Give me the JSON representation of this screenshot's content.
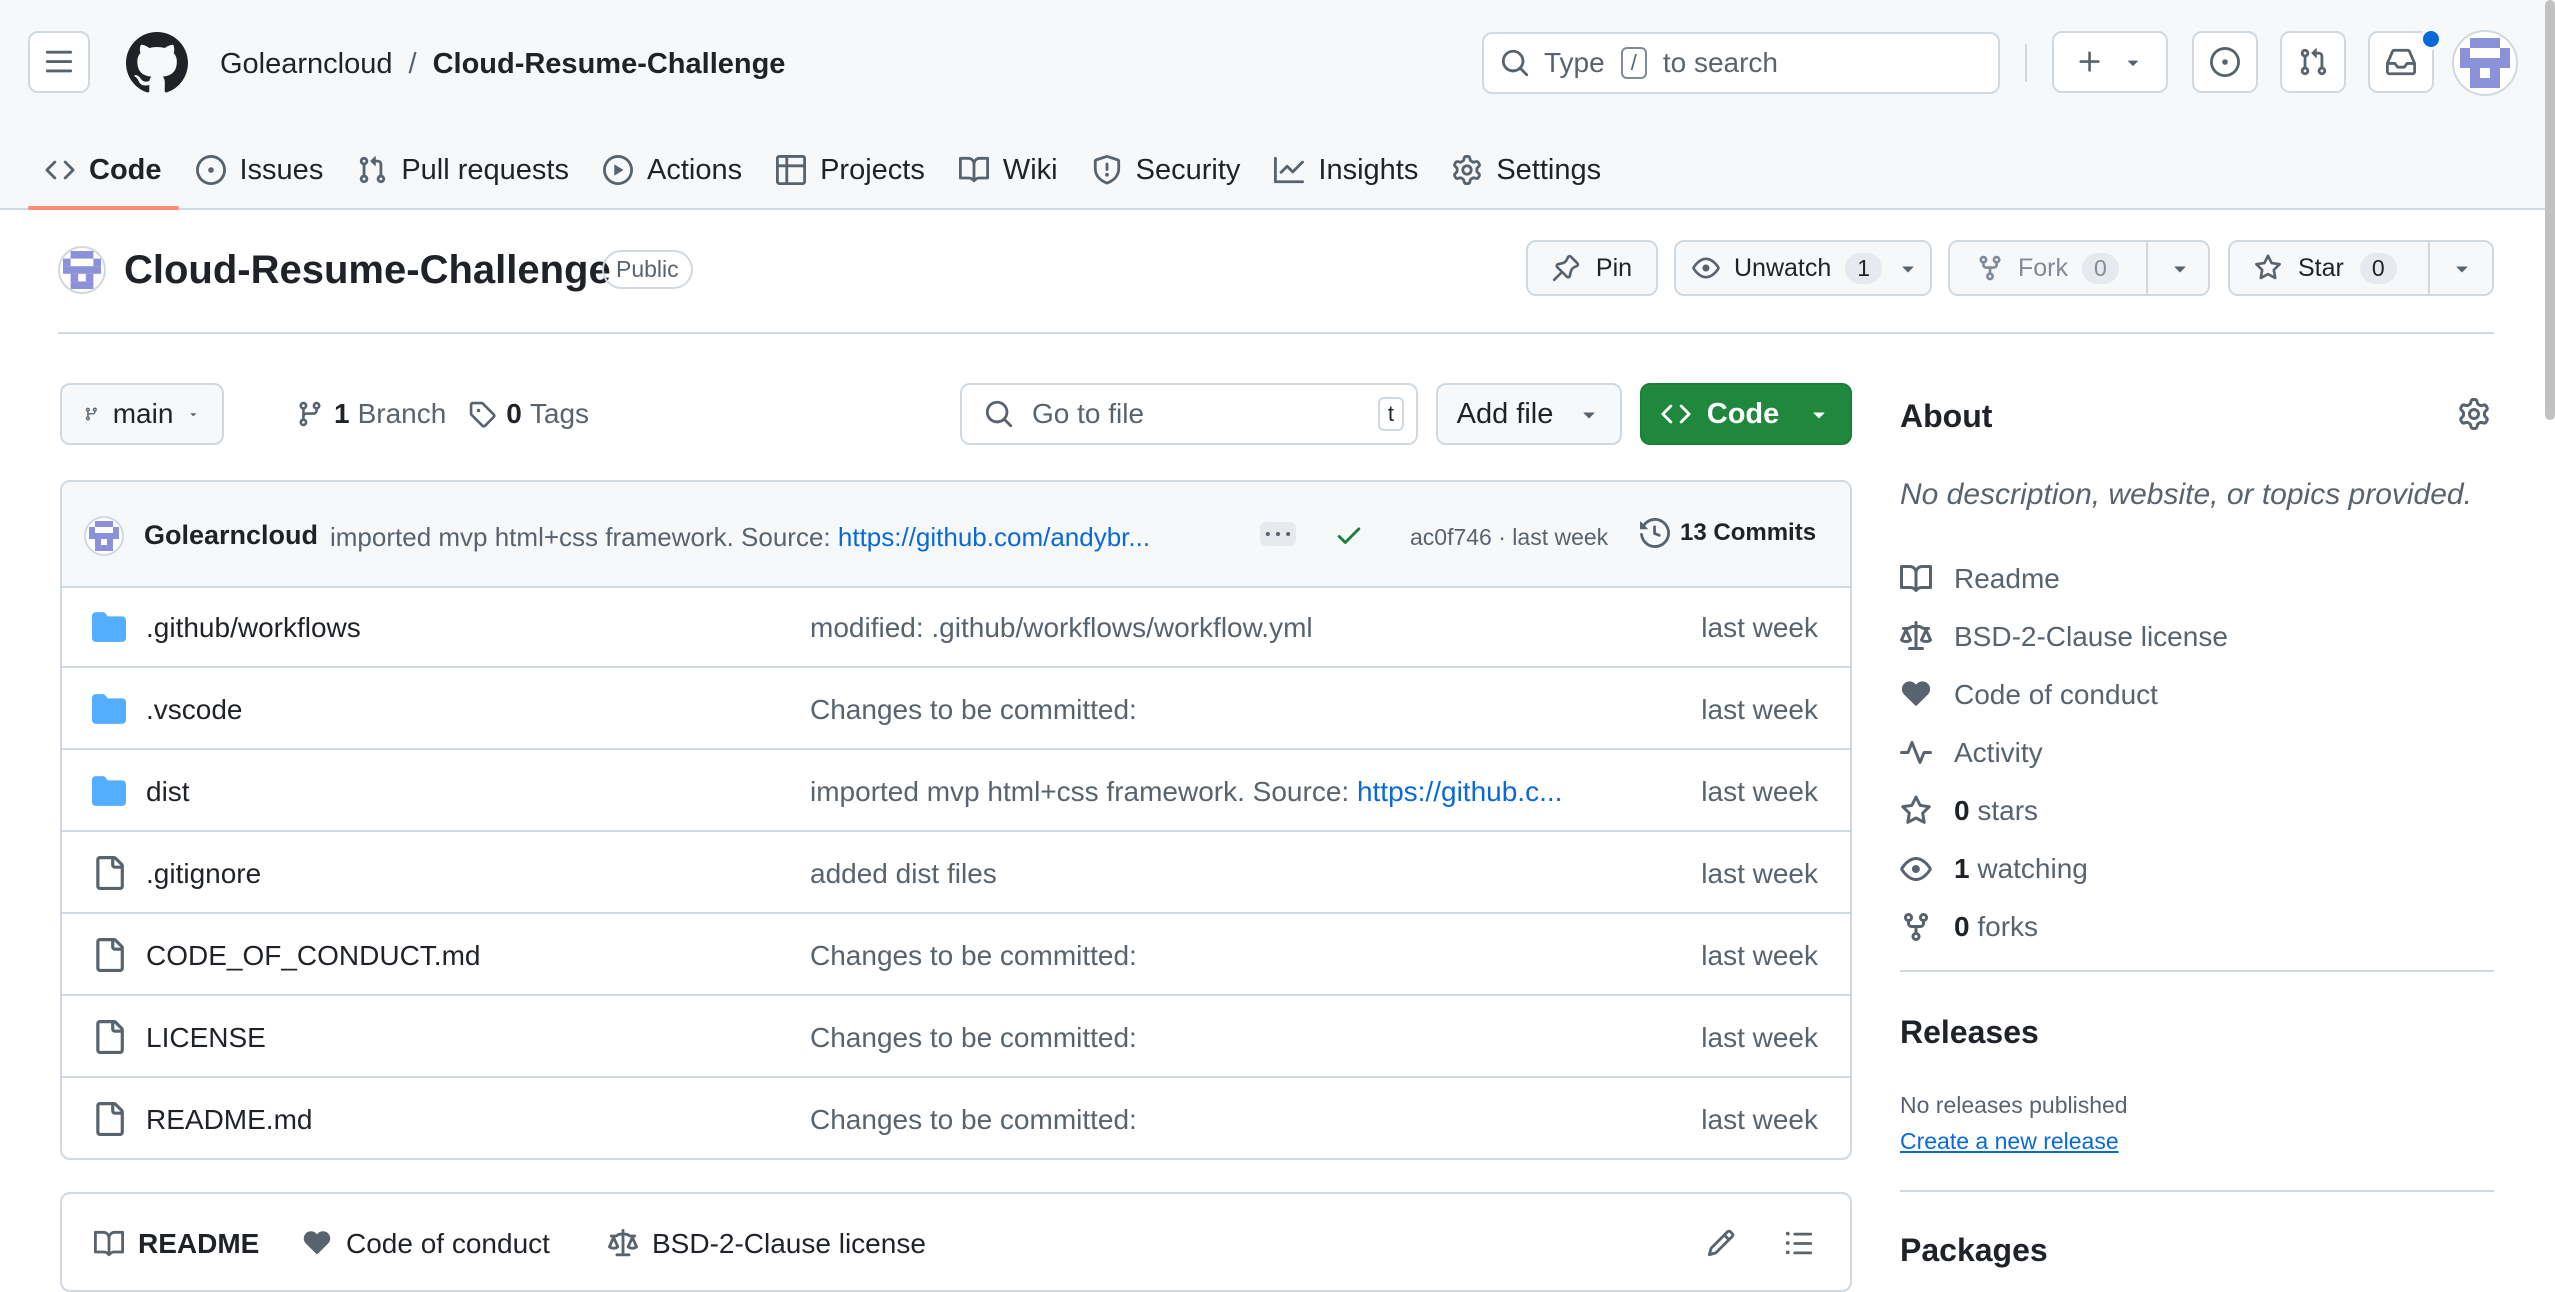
{
  "header": {
    "owner": "Golearncloud",
    "separator": "/",
    "repo": "Cloud-Resume-Challenge",
    "search_prefix": "Type",
    "search_key": "/",
    "search_suffix": "to search"
  },
  "tabs": [
    {
      "label": "Code",
      "icon": "code-icon"
    },
    {
      "label": "Issues",
      "icon": "issue-icon"
    },
    {
      "label": "Pull requests",
      "icon": "pull-request-icon"
    },
    {
      "label": "Actions",
      "icon": "play-icon"
    },
    {
      "label": "Projects",
      "icon": "table-icon"
    },
    {
      "label": "Wiki",
      "icon": "book-icon"
    },
    {
      "label": "Security",
      "icon": "shield-icon"
    },
    {
      "label": "Insights",
      "icon": "graph-icon"
    },
    {
      "label": "Settings",
      "icon": "gear-icon"
    }
  ],
  "repo_header": {
    "title": "Cloud-Resume-Challenge",
    "visibility": "Public",
    "pin_label": "Pin",
    "unwatch_label": "Unwatch",
    "watch_count": "1",
    "fork_label": "Fork",
    "fork_count": "0",
    "star_label": "Star",
    "star_count": "0"
  },
  "toolbar": {
    "branch": "main",
    "branch_count": "1",
    "branch_label": "Branch",
    "tag_count": "0",
    "tag_label": "Tags",
    "goto_placeholder": "Go to file",
    "goto_key": "t",
    "add_file_label": "Add file",
    "code_label": "Code"
  },
  "commit": {
    "author": "Golearncloud",
    "message": "imported mvp html+css framework. Source:",
    "link": "https://github.com/andybr...",
    "hash": "ac0f746 · last week",
    "commits_label": "13 Commits"
  },
  "files": [
    {
      "name": ".github/workflows",
      "type": "folder",
      "msg": "modified: .github/workflows/workflow.yml",
      "link": "",
      "date": "last week"
    },
    {
      "name": ".vscode",
      "type": "folder",
      "msg": "Changes to be committed:",
      "link": "",
      "date": "last week"
    },
    {
      "name": "dist",
      "type": "folder",
      "msg": "imported mvp html+css framework. Source:",
      "link": "https://github.c...",
      "date": "last week"
    },
    {
      "name": ".gitignore",
      "type": "file",
      "msg": "added dist files",
      "link": "",
      "date": "last week"
    },
    {
      "name": "CODE_OF_CONDUCT.md",
      "type": "file",
      "msg": "Changes to be committed:",
      "link": "",
      "date": "last week"
    },
    {
      "name": "LICENSE",
      "type": "file",
      "msg": "Changes to be committed:",
      "link": "",
      "date": "last week"
    },
    {
      "name": "README.md",
      "type": "file",
      "msg": "Changes to be committed:",
      "link": "",
      "date": "last week"
    }
  ],
  "readme_tabs": {
    "readme": "README",
    "conduct": "Code of conduct",
    "license": "BSD-2-Clause license"
  },
  "about": {
    "title": "About",
    "description": "No description, website, or topics provided.",
    "readme": "Readme",
    "license": "BSD-2-Clause license",
    "conduct": "Code of conduct",
    "activity": "Activity",
    "stars_count": "0",
    "stars_label": "stars",
    "watching_count": "1",
    "watching_label": "watching",
    "forks_count": "0",
    "forks_label": "forks"
  },
  "releases": {
    "title": "Releases",
    "none": "No releases published",
    "create": "Create a new release"
  },
  "packages": {
    "title": "Packages"
  },
  "colors": {
    "accent": "#0969da",
    "green": "#1f883d",
    "tab_underline": "#fd8c73",
    "folder": "#54aeff"
  }
}
